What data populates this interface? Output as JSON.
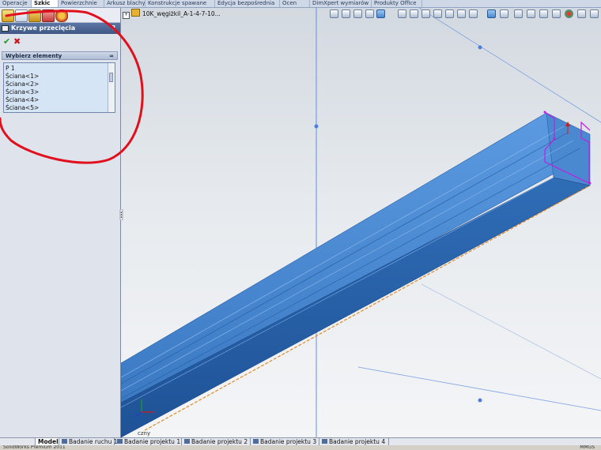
{
  "command_tabs": [
    "Operacje",
    "Szkic",
    "Powierzchnie",
    "Arkusz blachy",
    "Konstrukcje spawane",
    "Edycja bezpośrednia",
    "Ocen",
    "DimXpert wymiarów",
    "Produkty Office"
  ],
  "tree": {
    "root_label": "10K_węgiżkil_A-1-4-7-10..."
  },
  "property_manager": {
    "title": "Krzywe przecięcia",
    "help": "?",
    "ok_glyph": "✔",
    "cancel_glyph": "✖",
    "section_title": "Wybierz elementy",
    "section_collapse": "≈",
    "selection_items": [
      "P 1",
      "Ściana<1>",
      "Ściana<2>",
      "Ściana<3>",
      "Ściana<4>",
      "Ściana<5>"
    ]
  },
  "panel_tools": [
    "feature-manager-icon",
    "property-manager-icon",
    "config-manager-icon",
    "dimxpert-icon",
    "display-manager-icon"
  ],
  "view_tools": [
    "zoom-to-fit-icon",
    "zoom-area-icon",
    "pan-icon",
    "rotate-icon",
    "section-view-icon",
    "view-orientation-icon",
    "display-style-icon",
    "hide-show-icon",
    "edit-appearance-icon",
    "scene-icon"
  ],
  "origin_label": "czny",
  "bottom_tabs": [
    "Model",
    "Badanie ruchu 1",
    "Badanie projektu 1",
    "Badanie projektu 2",
    "Badanie projektu 3",
    "Badanie projektu 4"
  ],
  "status": {
    "left": "SolidWorks Premium 2011",
    "right": "MMGS"
  },
  "colors": {
    "part_blue": "#3f7fc6",
    "annotation_red": "#e0101e",
    "selection_magenta": "#c020e0",
    "axis_blue": "#5a8be0"
  }
}
